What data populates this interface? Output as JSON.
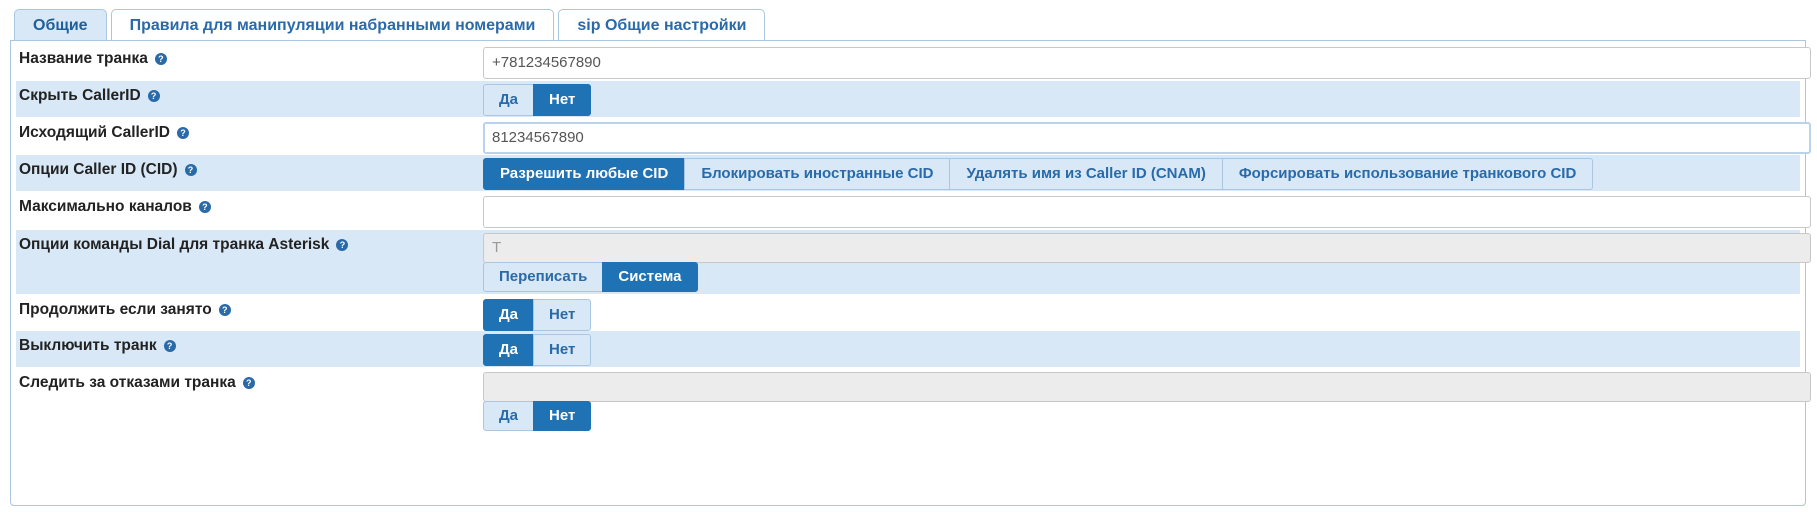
{
  "tabs": [
    {
      "label": "Общие",
      "active": true
    },
    {
      "label": "Правила для манипуляции набранными номерами",
      "active": false
    },
    {
      "label": "sip Общие настройки",
      "active": false
    }
  ],
  "help_glyph": "?",
  "rows": {
    "trunk_name": {
      "label": "Название транка",
      "value": "+781234567890"
    },
    "hide_callerid": {
      "label": "Скрыть CallerID",
      "yes": "Да",
      "no": "Нет",
      "selected": "no"
    },
    "outbound_callerid": {
      "label": "Исходящий CallerID",
      "value": "81234567890"
    },
    "cid_options": {
      "label": "Опции Caller ID (CID)",
      "options": [
        "Разрешить любые CID",
        "Блокировать иностранные CID",
        "Удалять имя из Caller ID (CNAM)",
        "Форсировать использование транкового CID"
      ],
      "selected_index": 0
    },
    "max_channels": {
      "label": "Максимально каналов",
      "value": ""
    },
    "dial_options": {
      "label": "Опции команды Dial для транка Asterisk",
      "value": "T",
      "override": "Переписать",
      "system": "Система",
      "selected": "system"
    },
    "continue_busy": {
      "label": "Продолжить если занято",
      "yes": "Да",
      "no": "Нет",
      "selected": "yes"
    },
    "disable_trunk": {
      "label": "Выключить транк",
      "yes": "Да",
      "no": "Нет",
      "selected": "yes"
    },
    "monitor_failures": {
      "label": "Следить за отказами транка",
      "value": "",
      "yes": "Да",
      "no": "Нет",
      "selected": "no"
    }
  },
  "colors": {
    "accent": "#1f72b4",
    "row_alt": "#d8e8f6",
    "tab_text": "#2a6aa8"
  }
}
